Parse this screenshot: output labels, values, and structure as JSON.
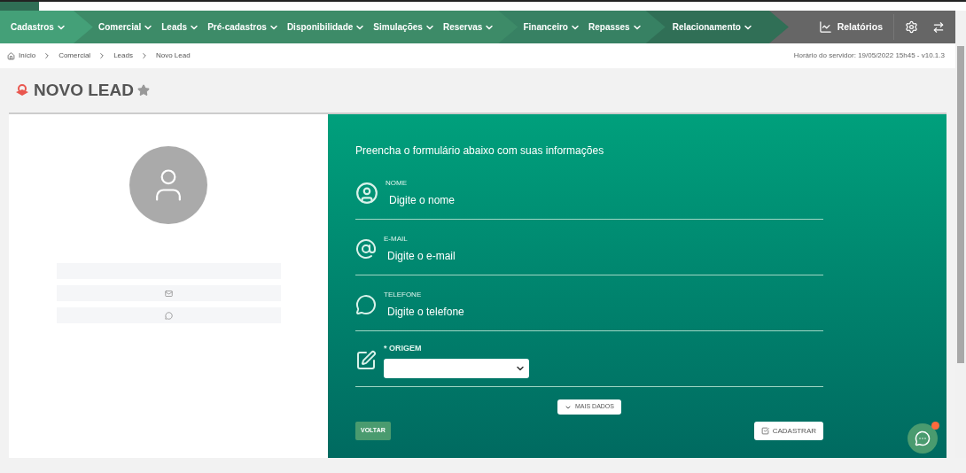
{
  "nav": {
    "groups": [
      {
        "items": [
          "Cadastros"
        ]
      },
      {
        "items": [
          "Comercial",
          "Leads",
          "Pré-cadastros",
          "Disponibilidade",
          "Simulações",
          "Reservas"
        ]
      },
      {
        "items": [
          "Financeiro",
          "Repasses"
        ]
      },
      {
        "items": [
          "Relacionamento"
        ]
      }
    ],
    "reports": "Relatórios"
  },
  "breadcrumb": [
    "Início",
    "Comercial",
    "Leads",
    "Novo Lead"
  ],
  "server_time": "Horário do servidor: 19/05/2022 15h45 - v10.1.3",
  "page_title": "NOVO LEAD",
  "form": {
    "heading": "Preencha o formulário abaixo com suas informações",
    "fields": [
      {
        "kind": "text",
        "label": "NOME",
        "placeholder": "Digite o nome"
      },
      {
        "kind": "text",
        "label": "E-MAIL",
        "placeholder": "Digite o e-mail"
      },
      {
        "kind": "text",
        "label": "TELEFONE",
        "placeholder": "Digite o telefone"
      },
      {
        "kind": "select",
        "label": "* ORIGEM"
      }
    ],
    "more_button": "MAIS DADOS",
    "back_button": "VOLTAR",
    "submit_button": "CADASTRAR"
  }
}
